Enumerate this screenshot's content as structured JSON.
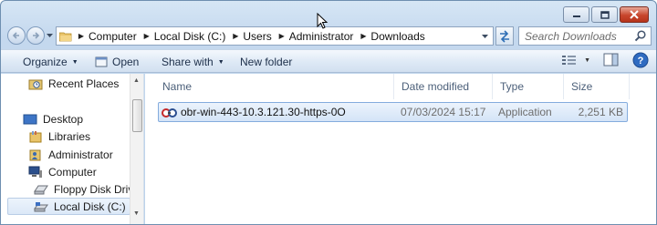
{
  "window": {
    "caption_buttons": [
      "minimize",
      "maximize",
      "close"
    ]
  },
  "address_bar": {
    "breadcrumbs": [
      "Computer",
      "Local Disk (C:)",
      "Users",
      "Administrator",
      "Downloads"
    ]
  },
  "search": {
    "placeholder": "Search Downloads"
  },
  "toolbar": {
    "organize": "Organize",
    "open": "Open",
    "share_with": "Share with",
    "new_folder": "New folder"
  },
  "nav_pane": {
    "items": [
      {
        "label": "Recent Places",
        "icon": "recent-places-icon"
      },
      {
        "label": "Desktop",
        "icon": "desktop-icon"
      },
      {
        "label": "Libraries",
        "icon": "libraries-icon"
      },
      {
        "label": "Administrator",
        "icon": "user-folder-icon"
      },
      {
        "label": "Computer",
        "icon": "computer-icon"
      },
      {
        "label": "Floppy Disk Drive",
        "icon": "floppy-drive-icon"
      },
      {
        "label": "Local Disk (C:)",
        "icon": "local-disk-icon"
      }
    ]
  },
  "columns": [
    "Name",
    "Date modified",
    "Type",
    "Size"
  ],
  "files": [
    {
      "name": "obr-win-443-10.3.121.30-https-0O",
      "date_modified": "07/03/2024 15:17",
      "type": "Application",
      "size": "2,251 KB",
      "icon": "openvpn-app-icon"
    }
  ],
  "colors": {
    "selection_border": "#84acdd",
    "selection_fill": "#d4e4f7",
    "toolbar_text": "#1d2f4a",
    "close_button": "#c8452c"
  }
}
